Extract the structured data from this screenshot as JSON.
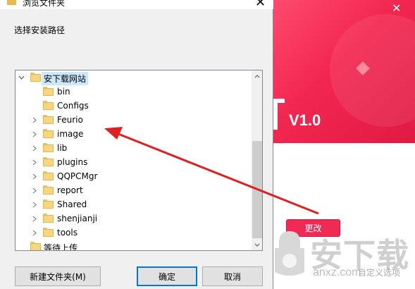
{
  "dialog": {
    "title": "浏览文件夹",
    "instruction": "选择安装路径",
    "buttons": {
      "new_folder": "新建文件夹(M)",
      "ok": "确定",
      "cancel": "取消"
    }
  },
  "tree": {
    "root": "安下载网站",
    "children": [
      {
        "label": "bin",
        "expandable": false
      },
      {
        "label": "Configs",
        "expandable": false
      },
      {
        "label": "Feurio",
        "expandable": true
      },
      {
        "label": "image",
        "expandable": true
      },
      {
        "label": "lib",
        "expandable": true
      },
      {
        "label": "plugins",
        "expandable": true
      },
      {
        "label": "QQPCMgr",
        "expandable": true
      },
      {
        "label": "report",
        "expandable": true
      },
      {
        "label": "Shared",
        "expandable": true
      },
      {
        "label": "shenjianji",
        "expandable": true
      },
      {
        "label": "tools",
        "expandable": true
      }
    ],
    "sibling": "等待上传"
  },
  "background": {
    "version": "V1.0",
    "change_button": "更改",
    "watermark": "安下载",
    "watermark_url": "anxz.com",
    "custom_option": "自定义选项",
    "accent_color": "#f12a55"
  },
  "icons": {
    "folder": "folder-icon",
    "expand": "chevron-right-icon",
    "collapse": "chevron-down-icon",
    "close": "close-icon"
  }
}
